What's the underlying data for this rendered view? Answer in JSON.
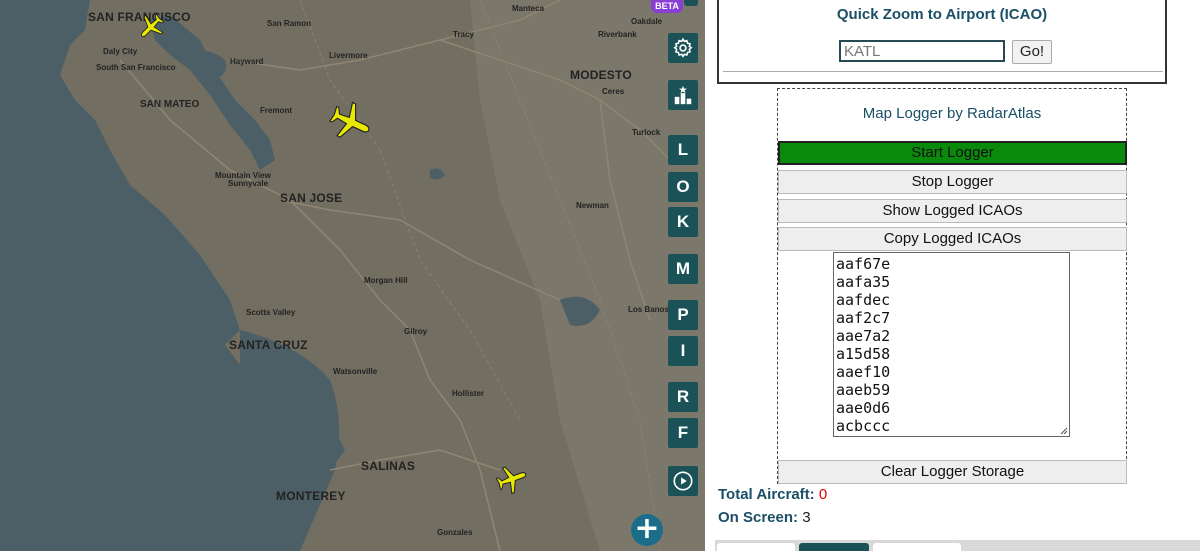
{
  "map": {
    "beta_badge": "BETA",
    "cities": [
      {
        "name": "SAN FRANCISCO",
        "size": "big"
      },
      {
        "name": "San Ramon",
        "size": "sm"
      },
      {
        "name": "Manteca",
        "size": "sm"
      },
      {
        "name": "Oakdale",
        "size": "sm"
      },
      {
        "name": "Tracy",
        "size": "sm"
      },
      {
        "name": "Riverbank",
        "size": "sm"
      },
      {
        "name": "Daly City",
        "size": "sm"
      },
      {
        "name": "South San Francisco",
        "size": "sm"
      },
      {
        "name": "Hayward",
        "size": "sm"
      },
      {
        "name": "Livermore",
        "size": "sm"
      },
      {
        "name": "MODESTO",
        "size": "big"
      },
      {
        "name": "Ceres",
        "size": "sm"
      },
      {
        "name": "SAN MATEO",
        "size": "mid"
      },
      {
        "name": "Fremont",
        "size": "sm"
      },
      {
        "name": "Turlock",
        "size": "sm"
      },
      {
        "name": "Mountain View",
        "size": "sm"
      },
      {
        "name": "Sunnyvale",
        "size": "sm"
      },
      {
        "name": "SAN JOSE",
        "size": "big"
      },
      {
        "name": "Newman",
        "size": "sm"
      },
      {
        "name": "Morgan Hill",
        "size": "sm"
      },
      {
        "name": "Scotts Valley",
        "size": "sm"
      },
      {
        "name": "Los Banos",
        "size": "sm"
      },
      {
        "name": "Gilroy",
        "size": "sm"
      },
      {
        "name": "SANTA CRUZ",
        "size": "big"
      },
      {
        "name": "Watsonville",
        "size": "sm"
      },
      {
        "name": "Hollister",
        "size": "sm"
      },
      {
        "name": "SALINAS",
        "size": "big"
      },
      {
        "name": "MONTEREY",
        "size": "big"
      },
      {
        "name": "Gonzales",
        "size": "sm"
      }
    ],
    "planes_on_screen": 3,
    "plane_color": "#e8e800",
    "tools": [
      {
        "icon": "gear-icon",
        "label": ""
      },
      {
        "icon": "leaderboard-icon",
        "label": ""
      },
      {
        "icon": "letter-L",
        "label": "L"
      },
      {
        "icon": "letter-O",
        "label": "O"
      },
      {
        "icon": "letter-K",
        "label": "K"
      },
      {
        "icon": "letter-M",
        "label": "M"
      },
      {
        "icon": "letter-P",
        "label": "P"
      },
      {
        "icon": "letter-I",
        "label": "I"
      },
      {
        "icon": "letter-R",
        "label": "R"
      },
      {
        "icon": "letter-F",
        "label": "F"
      },
      {
        "icon": "play-icon",
        "label": ""
      }
    ],
    "zoom_in_label": "+",
    "tool_color": "#1a5258"
  },
  "quick_zoom": {
    "title": "Quick Zoom to Airport (ICAO)",
    "input_value": "KATL",
    "go_label": "Go!"
  },
  "logger": {
    "title": "Map Logger by RadarAtlas",
    "start_label": "Start Logger",
    "stop_label": "Stop Logger",
    "show_label": "Show Logged ICAOs",
    "copy_label": "Copy Logged ICAOs",
    "clear_label": "Clear Logger Storage",
    "icaos": [
      "aaf67e",
      "aafa35",
      "aafdec",
      "aaf2c7",
      "aae7a2",
      "a15d58",
      "aaef10",
      "aaeb59",
      "aae0d6",
      "acbccc"
    ],
    "start_color": "#0a8a0a"
  },
  "stats": {
    "total_label": "Total Aircraft:",
    "total_value": "0",
    "onscreen_label": "On Screen:",
    "onscreen_value": "3"
  }
}
